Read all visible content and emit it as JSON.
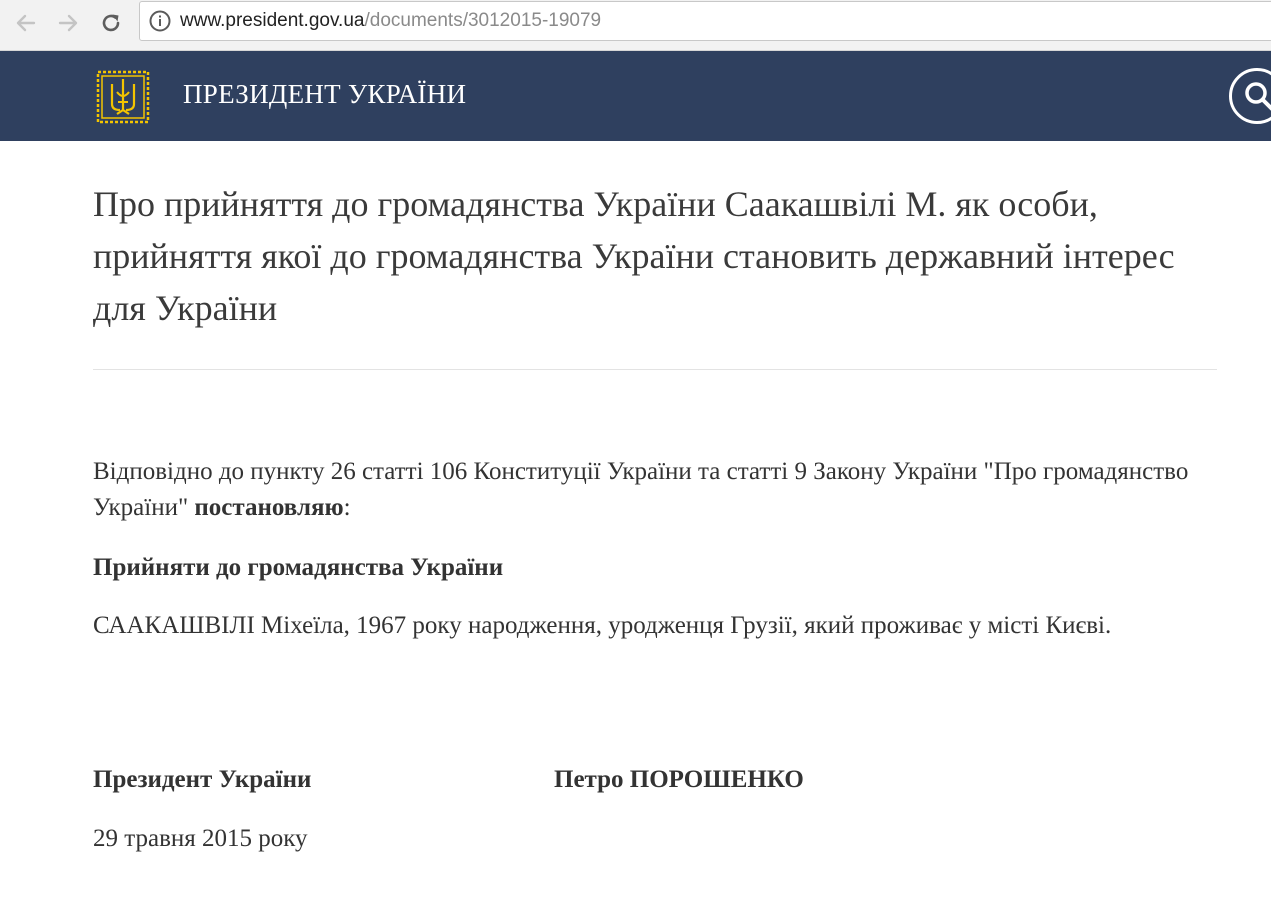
{
  "browser": {
    "url_host": "www.president.gov.ua",
    "url_path": "/documents/3012015-19079",
    "back_icon": "arrow-left-icon",
    "forward_icon": "arrow-right-icon",
    "reload_icon": "reload-icon",
    "info_icon": "info-circle-icon"
  },
  "header": {
    "title": "ПРЕЗИДЕНТ УКРАЇНИ",
    "logo_icon": "trident-emblem-icon",
    "search_icon": "search-icon",
    "background_color": "#2f405f",
    "emblem_color": "#f3c400"
  },
  "document": {
    "title": "Про прийняття до громадянства України Саакашвілі М. як особи, прийняття якої до громадянства України становить державний інтерес для України",
    "intro_text": "Відповідно до пункту 26 статті 106 Конституції України та статті 9 Закону України \"Про громадянство України\" ",
    "intro_bold": "постановляю",
    "intro_tail": ":",
    "resolution_heading": "Прийняти до громадянства України",
    "person_text": "СААКАШВІЛІ Міхеїла, 1967 року народження, уродженця Грузії, який проживає у місті Києві.",
    "signature_title": "Президент України",
    "signature_name": "Петро ПОРОШЕНКО",
    "date": "29 травня 2015 року"
  }
}
